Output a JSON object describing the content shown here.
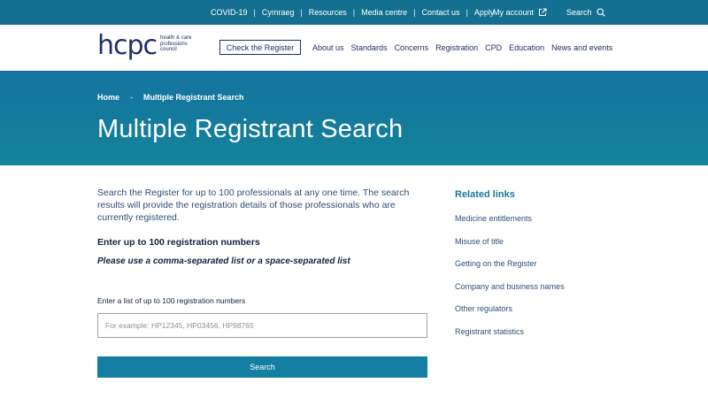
{
  "topbar": {
    "links": [
      "COVID-19",
      "Cymraeg",
      "Resources",
      "Media centre",
      "Contact us",
      "Apply"
    ],
    "separator": "|",
    "account_label": "My account",
    "search_label": "Search"
  },
  "header": {
    "logo_text": "hcpc",
    "logo_sub": [
      "health & care",
      "professions",
      "council"
    ],
    "check_register": "Check the Register",
    "nav": [
      "About us",
      "Standards",
      "Concerns",
      "Registration",
      "CPD",
      "Education",
      "News and events"
    ]
  },
  "hero": {
    "breadcrumb": [
      "Home",
      "Multiple Registrant Search"
    ],
    "breadcrumb_sep": "-",
    "title": "Multiple Registrant Search"
  },
  "main": {
    "intro": "Search the Register for up to 100 professionals at any one time. The search results will provide the registration details of those professionals who are currently registered.",
    "heading": "Enter up to 100 registration numbers",
    "subheading": "Please use a comma-separated list or a space-separated list",
    "field_label": "Enter a list of up to 100 registration numbers",
    "field_placeholder": "For example: HP12345, HP03456, HP98765",
    "field_value": "",
    "search_button": "Search"
  },
  "sidebar": {
    "title": "Related links",
    "links": [
      "Medicine entitlements",
      "Misuse of title",
      "Getting on the Register",
      "Company and business names",
      "Other regulators",
      "Registrant statistics"
    ]
  },
  "colors": {
    "topbar": "#147090",
    "hero": "#1574a0",
    "navy": "#1f2f6b",
    "accent": "#147ea3",
    "related_title": "#1a7a96"
  }
}
